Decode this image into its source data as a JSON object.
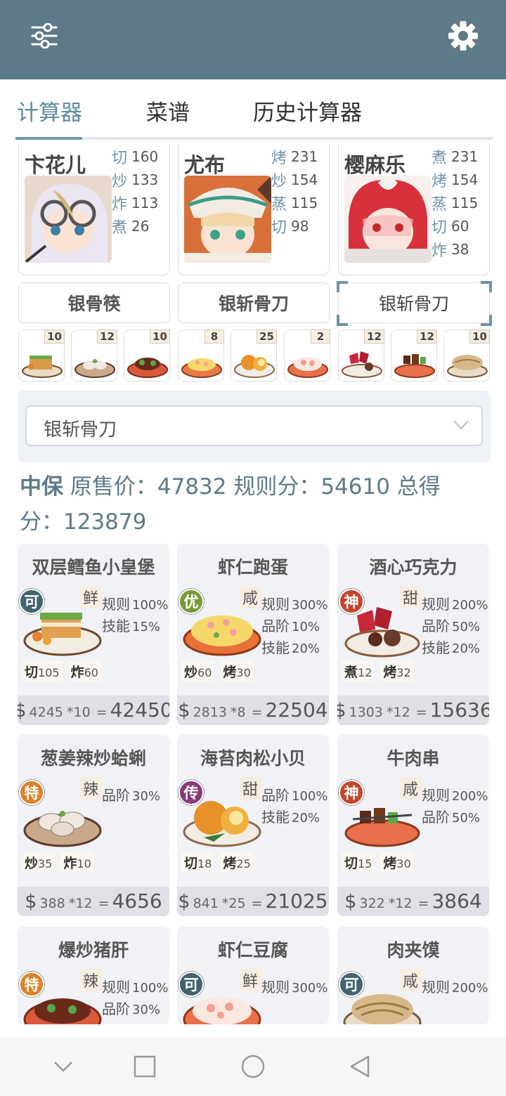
{
  "header": {
    "filter_icon": "sliders-icon",
    "settings_icon": "gear-icon"
  },
  "tabs": [
    {
      "label": "计算器",
      "active": true
    },
    {
      "label": "菜谱",
      "active": false
    },
    {
      "label": "历史计算器",
      "active": false
    }
  ],
  "chefs": [
    {
      "name": "卞花儿",
      "stats": [
        {
          "skill": "切",
          "value": "160"
        },
        {
          "skill": "炒",
          "value": "133"
        },
        {
          "skill": "炸",
          "value": "113"
        },
        {
          "skill": "煮",
          "value": "26"
        }
      ]
    },
    {
      "name": "尤布",
      "stats": [
        {
          "skill": "烤",
          "value": "231"
        },
        {
          "skill": "炒",
          "value": "154"
        },
        {
          "skill": "蒸",
          "value": "115"
        },
        {
          "skill": "切",
          "value": "98"
        }
      ]
    },
    {
      "name": "樱麻乐",
      "stats": [
        {
          "skill": "煮",
          "value": "231"
        },
        {
          "skill": "烤",
          "value": "154"
        },
        {
          "skill": "蒸",
          "value": "115"
        },
        {
          "skill": "切",
          "value": "60"
        },
        {
          "skill": "炸",
          "value": "38"
        }
      ]
    }
  ],
  "tools": [
    "银骨筷",
    "银斩骨刀",
    "银斩骨刀"
  ],
  "dish_counts": [
    "10",
    "12",
    "10",
    "8",
    "25",
    "2",
    "12",
    "12",
    "10"
  ],
  "selector": {
    "value": "银斩骨刀"
  },
  "summary": {
    "level": "中保",
    "text": " 原售价：47832 规则分：54610 总得分：123879"
  },
  "cards": [
    {
      "title": "双层鳕鱼小皇堡",
      "rarity": "可",
      "rarity_color": "#3f6470",
      "tag": "鲜",
      "mods": [
        {
          "k": "规则",
          "v": "100%"
        },
        {
          "k": "技能",
          "v": "15%"
        }
      ],
      "reqs": [
        {
          "k": "切",
          "v": "105"
        },
        {
          "k": "炸",
          "v": "60"
        }
      ],
      "price": "4245",
      "qty": "*10",
      "total": "42450"
    },
    {
      "title": "虾仁跑蛋",
      "rarity": "优",
      "rarity_color": "#7a9a38",
      "tag": "咸",
      "mods": [
        {
          "k": "规则",
          "v": "300%"
        },
        {
          "k": "品阶",
          "v": "10%"
        },
        {
          "k": "技能",
          "v": "20%"
        }
      ],
      "reqs": [
        {
          "k": "炒",
          "v": "60"
        },
        {
          "k": "烤",
          "v": "30"
        }
      ],
      "price": "2813",
      "qty": "*8",
      "total": "22504"
    },
    {
      "title": "酒心巧克力",
      "rarity": "神",
      "rarity_color": "#c4462c",
      "tag": "甜",
      "mods": [
        {
          "k": "规则",
          "v": "200%"
        },
        {
          "k": "品阶",
          "v": "50%"
        },
        {
          "k": "技能",
          "v": "20%"
        }
      ],
      "reqs": [
        {
          "k": "煮",
          "v": "12"
        },
        {
          "k": "烤",
          "v": "32"
        }
      ],
      "price": "1303",
      "qty": "*12",
      "total": "15636"
    },
    {
      "title": "葱姜辣炒蛤蜊",
      "rarity": "特",
      "rarity_color": "#d8842a",
      "tag": "辣",
      "mods": [
        {
          "k": "品阶",
          "v": "30%"
        }
      ],
      "reqs": [
        {
          "k": "炒",
          "v": "35"
        },
        {
          "k": "炸",
          "v": "10"
        }
      ],
      "price": "388",
      "qty": "*12",
      "total": "4656"
    },
    {
      "title": "海苔肉松小贝",
      "rarity": "传",
      "rarity_color": "#8a3a7a",
      "tag": "甜",
      "mods": [
        {
          "k": "品阶",
          "v": "100%"
        },
        {
          "k": "技能",
          "v": "20%"
        }
      ],
      "reqs": [
        {
          "k": "切",
          "v": "18"
        },
        {
          "k": "烤",
          "v": "25"
        }
      ],
      "price": "841",
      "qty": "*25",
      "total": "21025"
    },
    {
      "title": "牛肉串",
      "rarity": "神",
      "rarity_color": "#c4462c",
      "tag": "咸",
      "mods": [
        {
          "k": "规则",
          "v": "200%"
        },
        {
          "k": "品阶",
          "v": "50%"
        }
      ],
      "reqs": [
        {
          "k": "切",
          "v": "15"
        },
        {
          "k": "烤",
          "v": "30"
        }
      ],
      "price": "322",
      "qty": "*12",
      "total": "3864"
    },
    {
      "title": "爆炒猪肝",
      "rarity": "特",
      "rarity_color": "#d8842a",
      "tag": "辣",
      "mods": [
        {
          "k": "规则",
          "v": "100%"
        },
        {
          "k": "品阶",
          "v": "30%"
        }
      ]
    },
    {
      "title": "虾仁豆腐",
      "rarity": "可",
      "rarity_color": "#3f6470",
      "tag": "鲜",
      "mods": [
        {
          "k": "规则",
          "v": "300%"
        }
      ]
    },
    {
      "title": "肉夹馍",
      "rarity": "可",
      "rarity_color": "#3f6470",
      "tag": "咸",
      "mods": [
        {
          "k": "规则",
          "v": "200%"
        }
      ]
    }
  ],
  "navbar": {
    "back_icon": "chevron-down-icon",
    "recents_icon": "square-icon",
    "home_icon": "circle-icon",
    "back_nav_icon": "triangle-back-icon"
  }
}
